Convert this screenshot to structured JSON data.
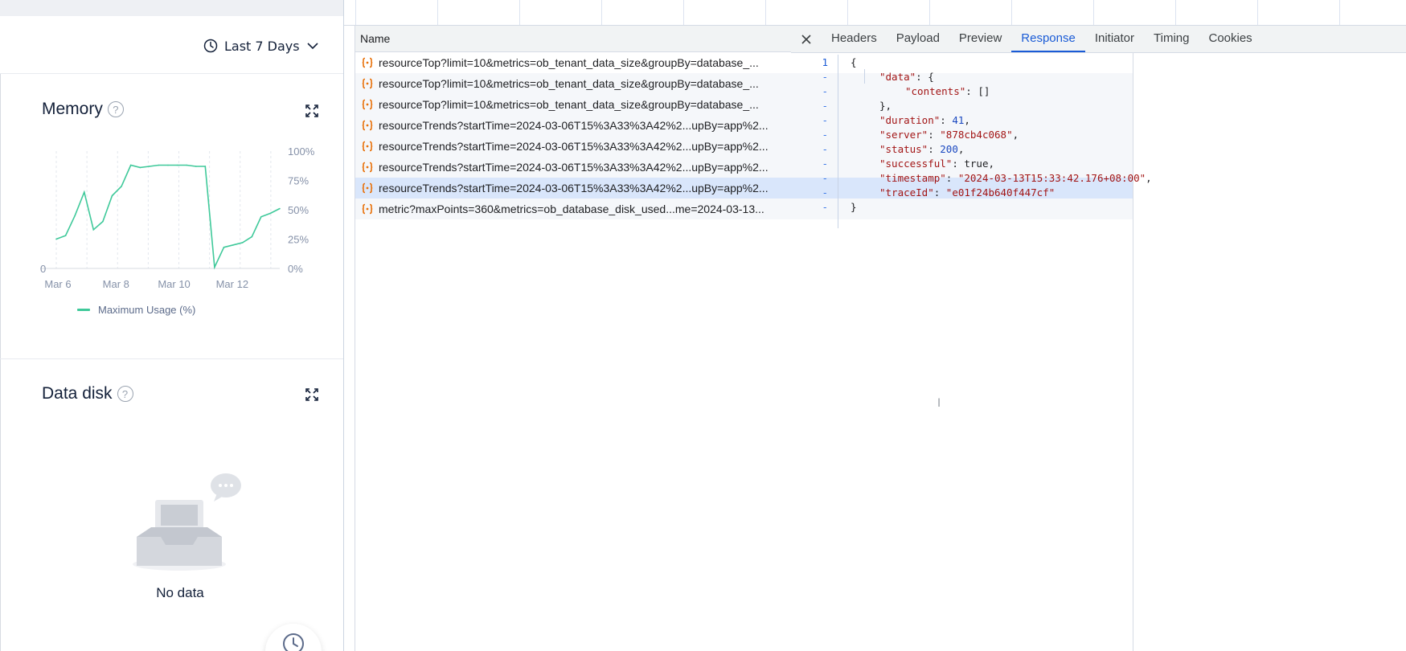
{
  "dashboard": {
    "time_range": "Last 7 Days",
    "memory_card": {
      "title": "Memory",
      "help": "?",
      "legend": "Maximum Usage (%)"
    },
    "data_disk_card": {
      "title": "Data disk",
      "help": "?",
      "empty_text": "No data"
    }
  },
  "chart_data": {
    "type": "line",
    "title": "Memory",
    "x": [
      "Mar 6",
      "Mar 6.25",
      "Mar 6.5",
      "Mar 6.75",
      "Mar 7",
      "Mar 7.25",
      "Mar 7.5",
      "Mar 7.75",
      "Mar 8",
      "Mar 8.25",
      "Mar 8.5",
      "Mar 8.75",
      "Mar 9",
      "Mar 9.5",
      "Mar 10",
      "Mar 10.5",
      "Mar 10.75",
      "Mar 11",
      "Mar 11.25",
      "Mar 11.5",
      "Mar 11.75",
      "Mar 12",
      "Mar 12.25",
      "Mar 12.5",
      "Mar 12.75"
    ],
    "series": [
      {
        "name": "Maximum Usage (%)",
        "values": [
          25,
          28,
          45,
          65,
          33,
          40,
          62,
          70,
          88,
          86,
          87,
          88,
          88,
          88,
          88,
          87,
          87,
          1,
          18,
          20,
          22,
          27,
          44,
          47,
          51
        ]
      }
    ],
    "xticks": [
      "Mar 6",
      "Mar 8",
      "Mar 10",
      "Mar 12"
    ],
    "yticks_right": [
      "100%",
      "75%",
      "50%",
      "25%",
      "0%"
    ],
    "ytick_left": "0",
    "ylim": [
      0,
      100
    ],
    "grid": "vertical dashed",
    "legend_position": "bottom",
    "colors": {
      "line": "#3fc99a"
    }
  },
  "devtools": {
    "list_header": "Name",
    "requests": [
      {
        "name": "resourceTop?limit=10&metrics=ob_tenant_data_size&groupBy=database_..."
      },
      {
        "name": "resourceTop?limit=10&metrics=ob_tenant_data_size&groupBy=database_..."
      },
      {
        "name": "resourceTop?limit=10&metrics=ob_tenant_data_size&groupBy=database_..."
      },
      {
        "name": "resourceTrends?startTime=2024-03-06T15%3A33%3A42%2...upBy=app%2..."
      },
      {
        "name": "resourceTrends?startTime=2024-03-06T15%3A33%3A42%2...upBy=app%2..."
      },
      {
        "name": "resourceTrends?startTime=2024-03-06T15%3A33%3A42%2...upBy=app%2..."
      },
      {
        "name": "resourceTrends?startTime=2024-03-06T15%3A33%3A42%2...upBy=app%2..."
      },
      {
        "name": "metric?maxPoints=360&metrics=ob_database_disk_used...me=2024-03-13..."
      }
    ],
    "tabs": [
      "Headers",
      "Payload",
      "Preview",
      "Response",
      "Initiator",
      "Timing",
      "Cookies"
    ],
    "active_tab": "Response",
    "response": {
      "gutter_first": "1",
      "gutter_dash": "-",
      "lines": {
        "l1": "{",
        "l2_key": "\"data\"",
        "l2_rest": ": {",
        "l3_key": "\"contents\"",
        "l3_rest": ": []",
        "l4": "},",
        "l5_key": "\"duration\"",
        "l5_val": "41",
        "l6_key": "\"server\"",
        "l6_val": "\"878cb4c068\"",
        "l7_key": "\"status\"",
        "l7_val": "200",
        "l8_key": "\"successful\"",
        "l8_val": "true",
        "l9_key": "\"timestamp\"",
        "l9_val": "\"2024-03-13T15:33:42.176+08:00\"",
        "l10_key": "\"traceId\"",
        "l10_val": "\"e01f24b640f447cf\"",
        "l11": "}"
      }
    }
  }
}
